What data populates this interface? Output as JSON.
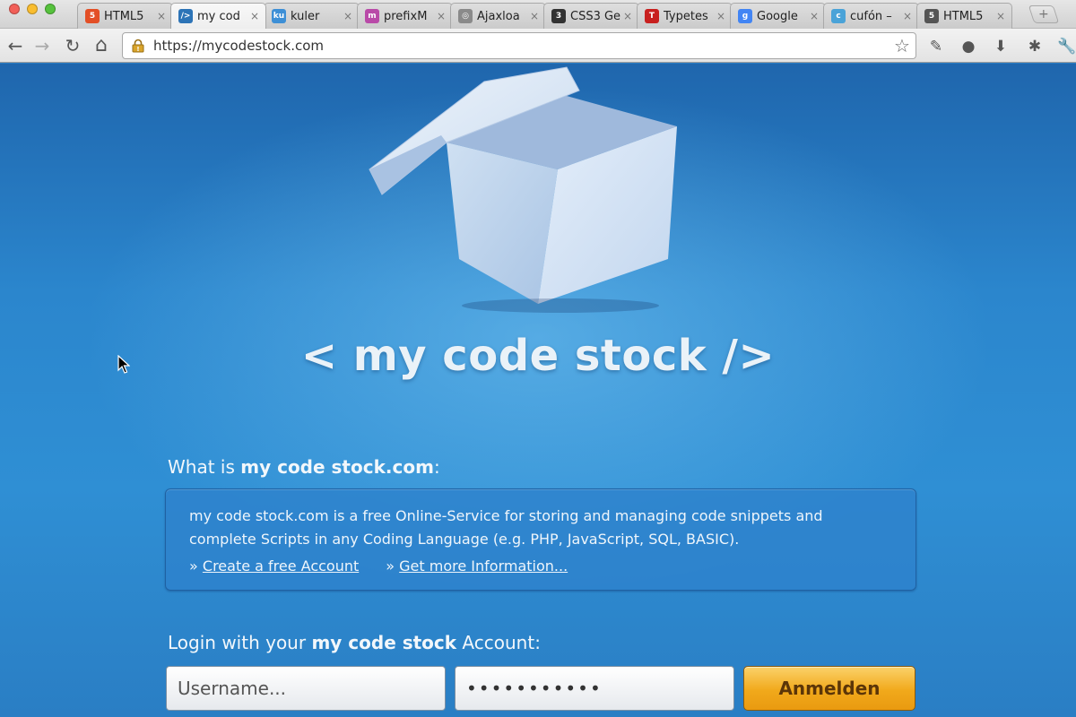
{
  "browser": {
    "tabs": [
      {
        "label": "HTML5",
        "icon": "html5-icon",
        "fav_text": "5",
        "fav_color": "#e34f26",
        "active": false
      },
      {
        "label": "my cod",
        "icon": "mycodestock-icon",
        "fav_text": "/>",
        "fav_color": "#2d74b7",
        "active": true
      },
      {
        "label": "kuler",
        "icon": "kuler-icon",
        "fav_text": "ku",
        "fav_color": "#3d8fd6",
        "active": false
      },
      {
        "label": "prefixM",
        "icon": "prefixmycss-icon",
        "fav_text": "m",
        "fav_color": "#b94aa8",
        "active": false
      },
      {
        "label": "Ajaxloa",
        "icon": "globe-icon",
        "fav_text": "◎",
        "fav_color": "#8a8a8a",
        "active": false
      },
      {
        "label": "CSS3 Ge",
        "icon": "css3-generator-icon",
        "fav_text": "3",
        "fav_color": "#333333",
        "active": false
      },
      {
        "label": "Typetes",
        "icon": "typetester-icon",
        "fav_text": "T",
        "fav_color": "#c8201f",
        "active": false
      },
      {
        "label": "Google",
        "icon": "google-icon",
        "fav_text": "g",
        "fav_color": "#4285f4",
        "active": false
      },
      {
        "label": "cufón –",
        "icon": "cufon-icon",
        "fav_text": "c",
        "fav_color": "#4aa3d8",
        "active": false
      },
      {
        "label": "HTML5",
        "icon": "html5-please-icon",
        "fav_text": "5",
        "fav_color": "#555555",
        "active": false
      }
    ],
    "tab_close": "×",
    "new_tab": "+",
    "nav": {
      "back": "←",
      "forward": "→",
      "reload": "↻",
      "home": "⌂"
    },
    "url": "https://mycodestock.com",
    "star": "☆",
    "extensions": [
      {
        "name": "wrench-ext-icon",
        "glyph": "✎"
      },
      {
        "name": "evernote-ext-icon",
        "glyph": "●"
      },
      {
        "name": "download-ext-icon",
        "glyph": "⬇"
      },
      {
        "name": "bug-ext-icon",
        "glyph": "✱"
      },
      {
        "name": "settings-wrench-icon",
        "glyph": "🔧"
      }
    ]
  },
  "page": {
    "logo": "< my code stock />",
    "about": {
      "prefix": "What is ",
      "brand": "my code stock.com",
      "suffix": ":",
      "description": "my code stock.com is a free Online-Service for storing and managing code snippets and complete Scripts in any Coding Language (e.g. PHP, JavaScript, SQL, BASIC).",
      "link_marker": "»",
      "links": [
        "Create a free Account",
        "Get more Information..."
      ]
    },
    "login": {
      "prefix": "Login with your ",
      "brand": "my code stock",
      "suffix": " Account:",
      "username_placeholder": "Username...",
      "password_value": "•••••••••••",
      "submit": "Anmelden"
    }
  },
  "colors": {
    "page_blue": "#2a7cc4",
    "button_orange": "#f1a91b",
    "logo_text": "#eaf2f8"
  }
}
